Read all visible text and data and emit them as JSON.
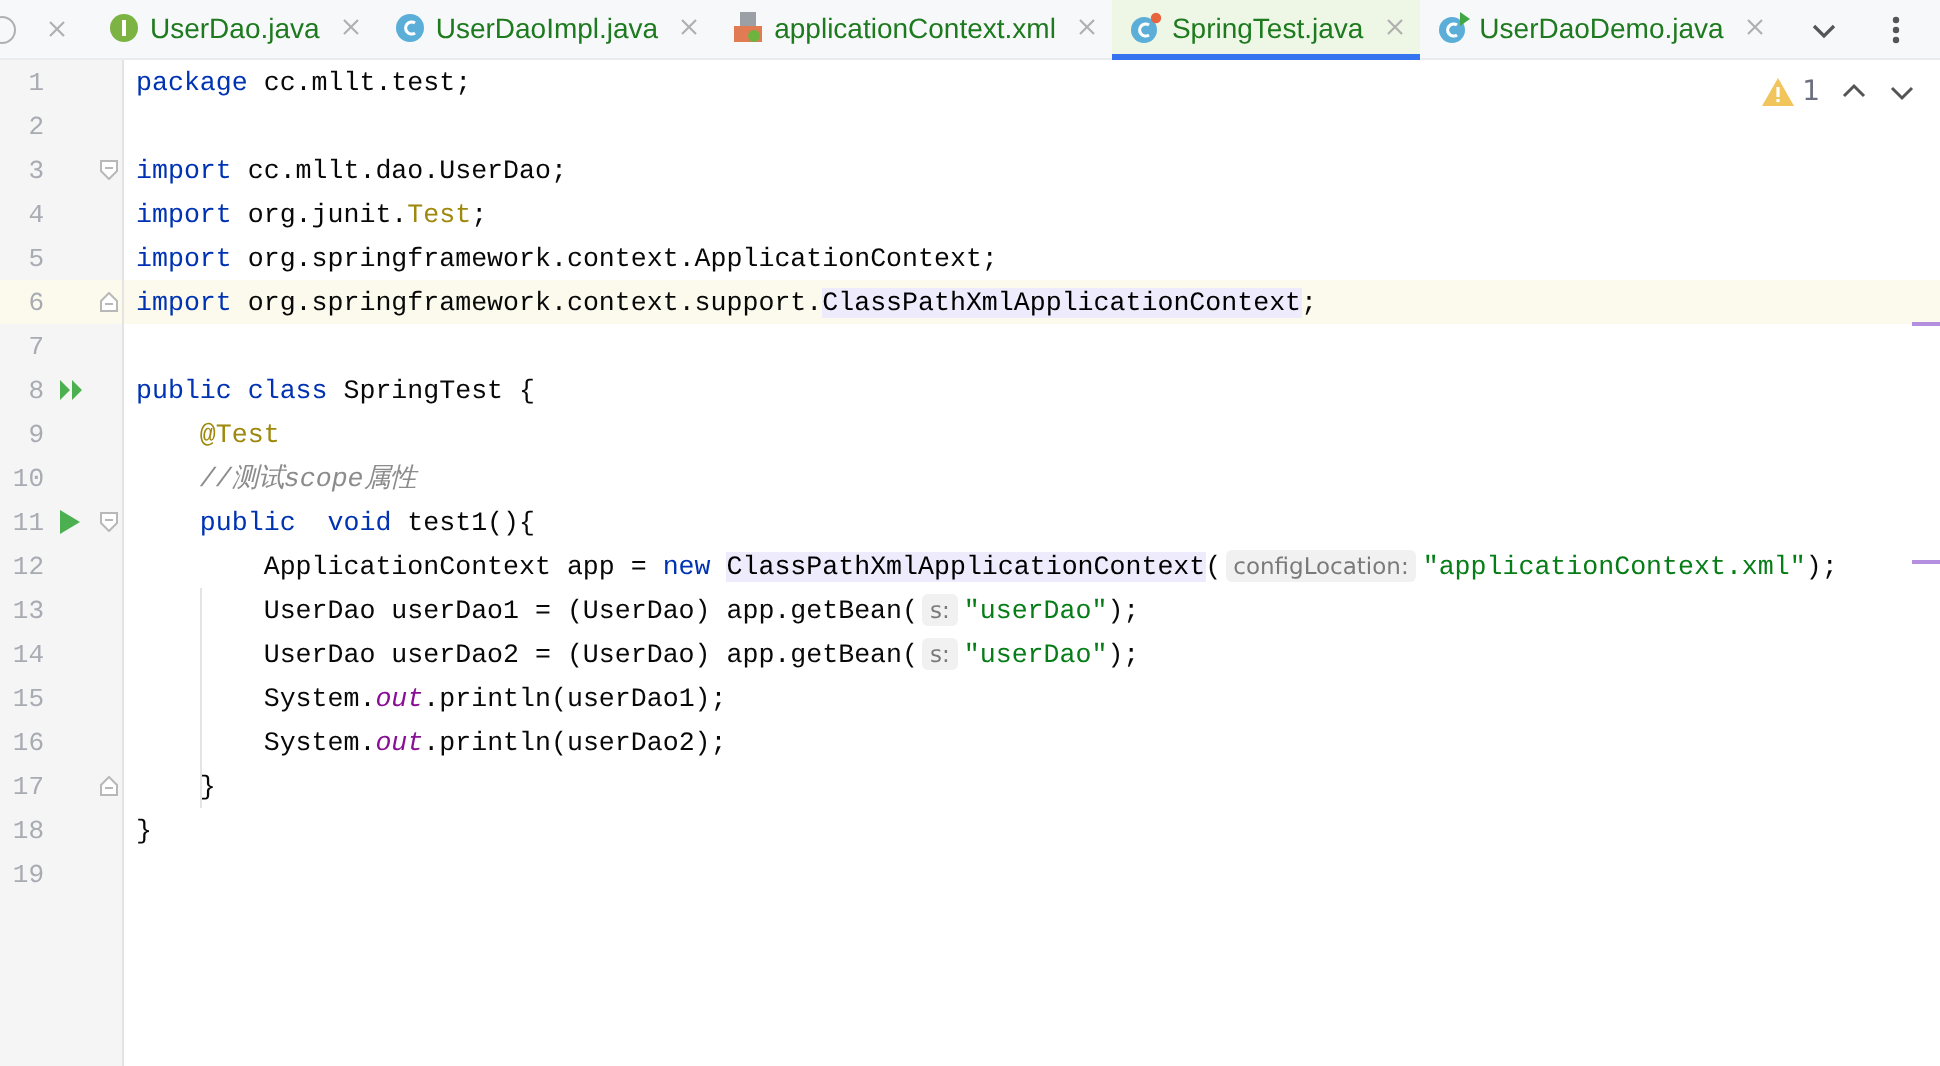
{
  "tabs": [
    {
      "label": "UserDao.java",
      "kind": "interface",
      "selected": false
    },
    {
      "label": "UserDaoImpl.java",
      "kind": "class",
      "selected": false
    },
    {
      "label": "applicationContext.xml",
      "kind": "xml",
      "selected": false
    },
    {
      "label": "SpringTest.java",
      "kind": "test-class",
      "selected": true
    },
    {
      "label": "UserDaoDemo.java",
      "kind": "runnable-class",
      "selected": false
    }
  ],
  "inspections": {
    "warnings": "1"
  },
  "lines": [
    {
      "number": "1",
      "tokens": [
        {
          "kind": "kw",
          "text": "package"
        },
        {
          "kind": "plain",
          "text": " cc.mllt.test;"
        }
      ]
    },
    {
      "number": "2"
    },
    {
      "number": "3",
      "markers": [
        {
          "kind": "fold-start"
        }
      ],
      "tokens": [
        {
          "kind": "kw",
          "text": "import"
        },
        {
          "kind": "plain",
          "text": " cc.mllt.dao.UserDao;"
        }
      ]
    },
    {
      "number": "4",
      "tokens": [
        {
          "kind": "kw",
          "text": "import"
        },
        {
          "kind": "plain",
          "text": " org.junit."
        },
        {
          "kind": "ann",
          "text": "Test"
        },
        {
          "kind": "plain",
          "text": ";"
        }
      ]
    },
    {
      "number": "5",
      "tokens": [
        {
          "kind": "kw",
          "text": "import"
        },
        {
          "kind": "plain",
          "text": " org.springframework.context.ApplicationContext;"
        }
      ]
    },
    {
      "number": "6",
      "markers": [
        {
          "kind": "fold-end"
        }
      ],
      "current": true,
      "tokens": [
        {
          "kind": "kw",
          "text": "import"
        },
        {
          "kind": "plain",
          "text": " org.springframework.context.support."
        },
        {
          "kind": "ref",
          "text": "ClassPathXmlApplicationContext"
        },
        {
          "kind": "plain",
          "text": ";"
        }
      ]
    },
    {
      "number": "7"
    },
    {
      "number": "8",
      "markers": [
        {
          "kind": "run-all"
        }
      ],
      "tokens": [
        {
          "kind": "kw",
          "text": "public class"
        },
        {
          "kind": "plain",
          "text": " SpringTest {"
        }
      ]
    },
    {
      "number": "9",
      "tokens": [
        {
          "kind": "ann",
          "text": "    @Test"
        }
      ]
    },
    {
      "number": "10",
      "tokens": [
        {
          "kind": "comment",
          "text": "    //测试scope属性"
        }
      ]
    },
    {
      "number": "11",
      "markers": [
        {
          "kind": "run"
        },
        {
          "kind": "fold-start"
        }
      ],
      "tokens": [
        {
          "kind": "kw",
          "text": "    public  void"
        },
        {
          "kind": "plain",
          "text": " test1(){"
        }
      ]
    },
    {
      "number": "12",
      "tokens": [
        {
          "kind": "plain",
          "text": "        ApplicationContext app = "
        },
        {
          "kind": "kw",
          "text": "new "
        },
        {
          "kind": "ref",
          "text": "ClassPathXmlApplicationContext"
        },
        {
          "kind": "plain",
          "text": "("
        },
        {
          "kind": "hint",
          "text": "configLocation:"
        },
        {
          "kind": "str",
          "text": "\"applicationContext.xml\""
        },
        {
          "kind": "plain",
          "text": ");"
        }
      ]
    },
    {
      "number": "13",
      "tokens": [
        {
          "kind": "plain",
          "text": "        UserDao userDao1 = (UserDao) app.getBean("
        },
        {
          "kind": "hint",
          "text": "s:"
        },
        {
          "kind": "str",
          "text": "\"userDao\""
        },
        {
          "kind": "plain",
          "text": ");"
        }
      ]
    },
    {
      "number": "14",
      "tokens": [
        {
          "kind": "plain",
          "text": "        UserDao userDao2 = (UserDao) app.getBean("
        },
        {
          "kind": "hint",
          "text": "s:"
        },
        {
          "kind": "str",
          "text": "\"userDao\""
        },
        {
          "kind": "plain",
          "text": ");"
        }
      ]
    },
    {
      "number": "15",
      "tokens": [
        {
          "kind": "plain",
          "text": "        System."
        },
        {
          "kind": "static",
          "text": "out"
        },
        {
          "kind": "plain",
          "text": ".println(userDao1);"
        }
      ]
    },
    {
      "number": "16",
      "tokens": [
        {
          "kind": "plain",
          "text": "        System."
        },
        {
          "kind": "static",
          "text": "out"
        },
        {
          "kind": "plain",
          "text": ".println(userDao2);"
        }
      ]
    },
    {
      "number": "17",
      "markers": [
        {
          "kind": "fold-end"
        }
      ],
      "tokens": [
        {
          "kind": "plain",
          "text": "    }"
        }
      ]
    },
    {
      "number": "18",
      "tokens": [
        {
          "kind": "plain",
          "text": "}"
        }
      ]
    },
    {
      "number": "19"
    }
  ]
}
